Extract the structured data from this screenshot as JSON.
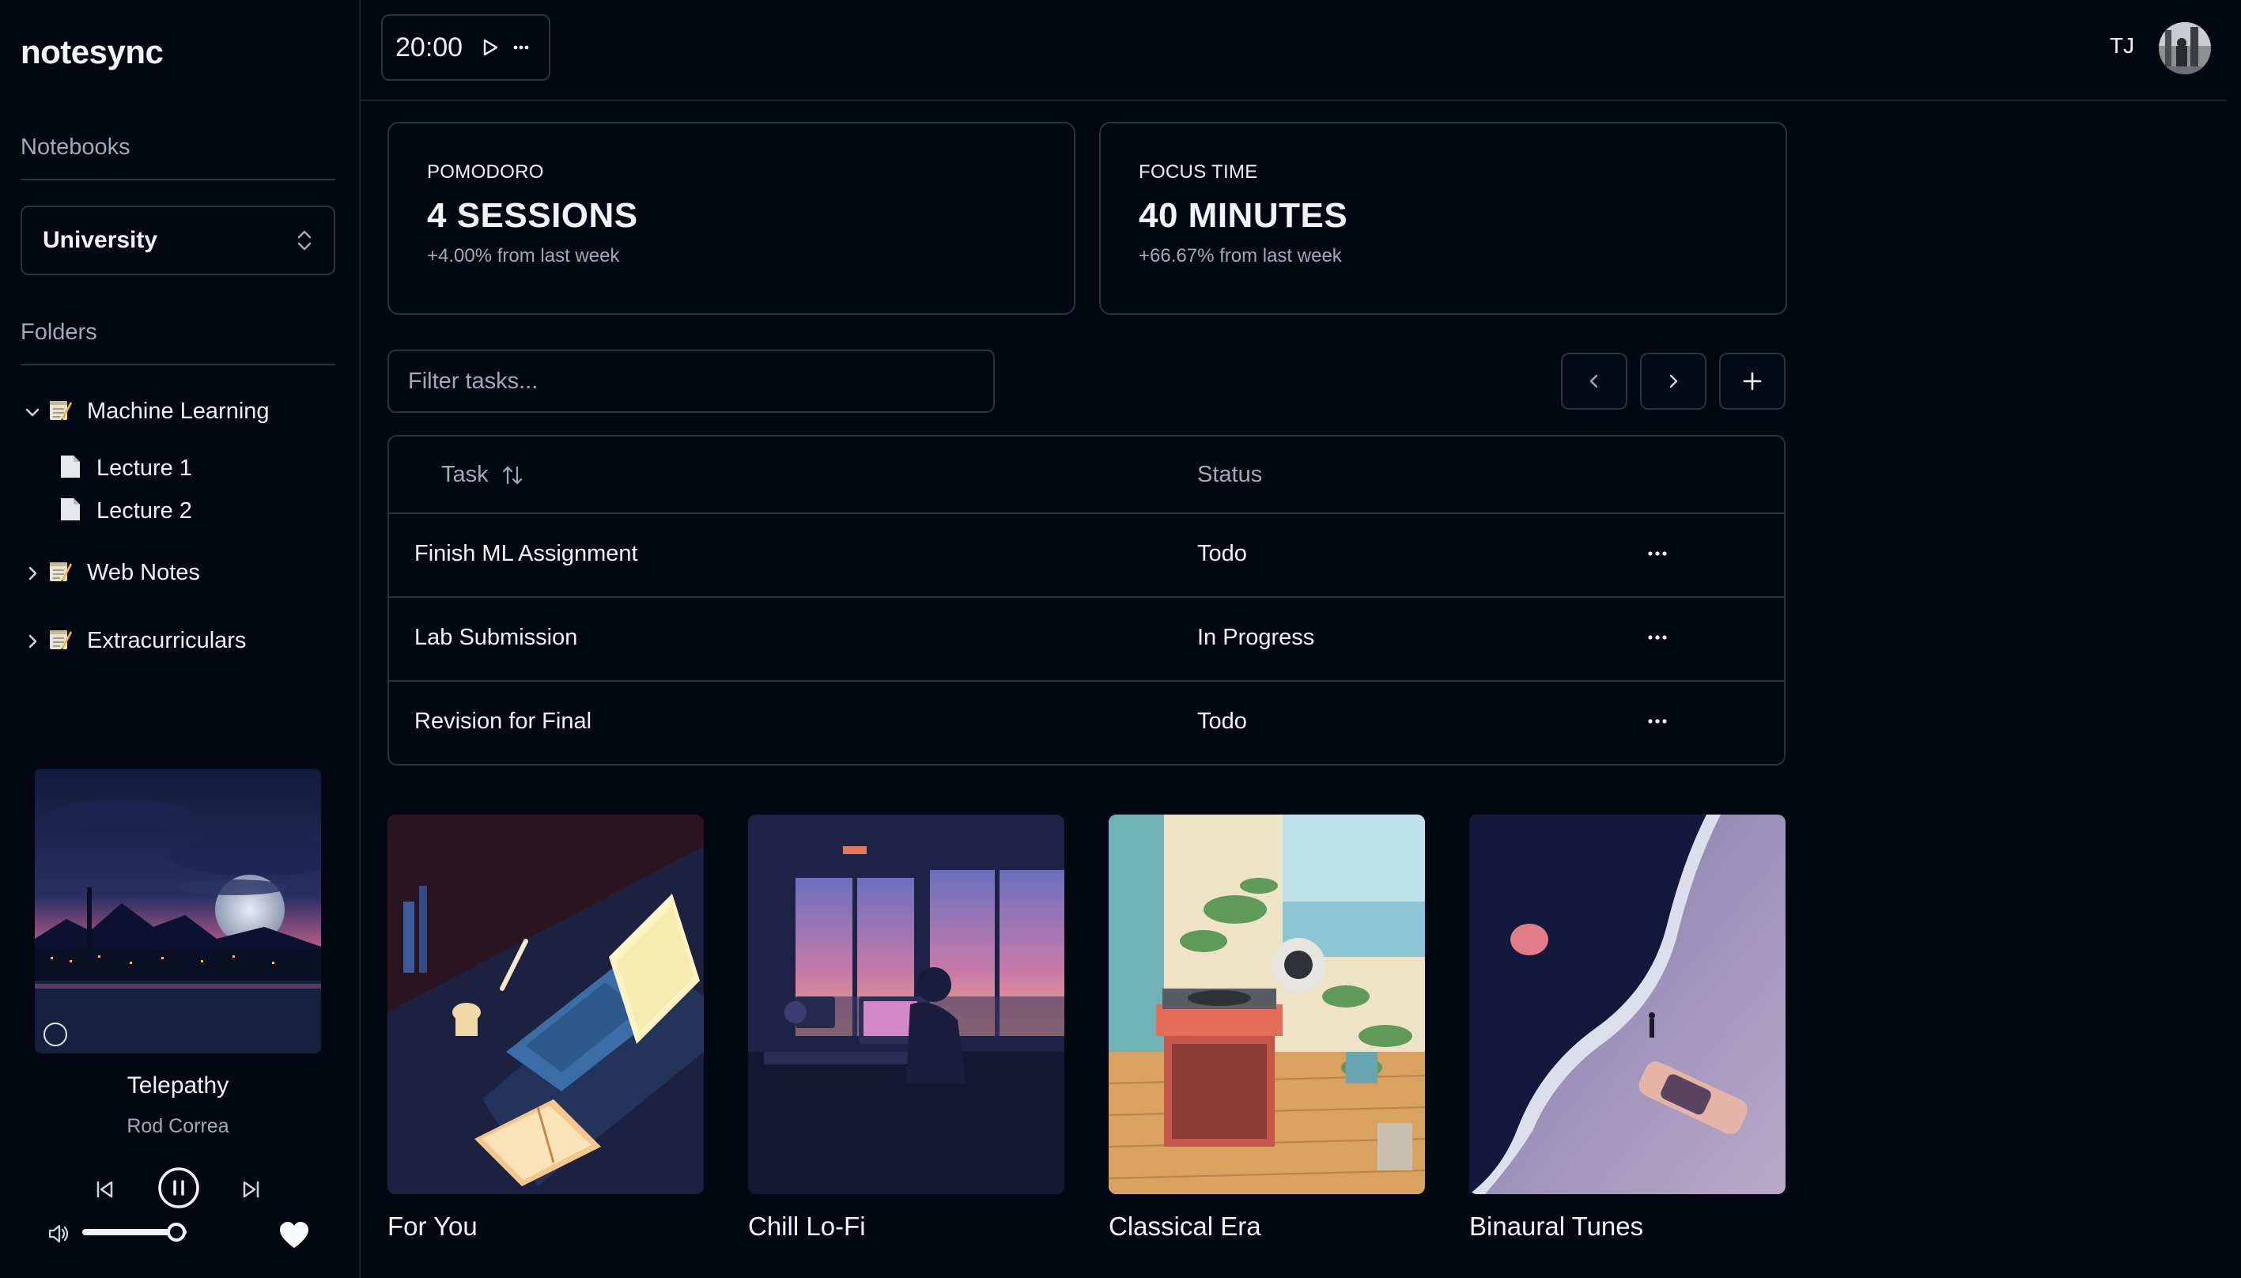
{
  "app": {
    "brand": "notesync"
  },
  "sidebar": {
    "notebooks_label": "Notebooks",
    "notebook_selected": "University",
    "folders_label": "Folders",
    "folders": [
      {
        "label": "Machine Learning",
        "expanded": true,
        "children": [
          {
            "label": "Lecture 1"
          },
          {
            "label": "Lecture 2"
          }
        ]
      },
      {
        "label": "Web Notes",
        "expanded": false
      },
      {
        "label": "Extracurriculars",
        "expanded": false
      }
    ]
  },
  "player": {
    "title": "Telepathy",
    "artist": "Rod Correa",
    "state": "playing",
    "volume_fraction": 0.9,
    "liked": true
  },
  "topbar": {
    "timer": "20:00",
    "user_initials": "TJ"
  },
  "stats": [
    {
      "eyebrow": "POMODORO",
      "value": "4 SESSIONS",
      "delta": "+4.00% from last week"
    },
    {
      "eyebrow": "FOCUS TIME",
      "value": "40 MINUTES",
      "delta": "+66.67% from last week"
    }
  ],
  "tasks": {
    "filter_placeholder": "Filter tasks...",
    "columns": {
      "task": "Task",
      "status": "Status"
    },
    "rows": [
      {
        "task": "Finish ML Assignment",
        "status": "Todo"
      },
      {
        "task": "Lab Submission",
        "status": "In Progress"
      },
      {
        "task": "Revision for Final",
        "status": "Todo"
      }
    ]
  },
  "playlists": [
    {
      "label": "For You"
    },
    {
      "label": "Chill Lo-Fi"
    },
    {
      "label": "Classical Era"
    },
    {
      "label": "Binaural Tunes"
    }
  ],
  "colors": {
    "background": "#030712",
    "border": "#2a3141",
    "text": "#f1f3f7",
    "muted": "#a2a9b6"
  }
}
